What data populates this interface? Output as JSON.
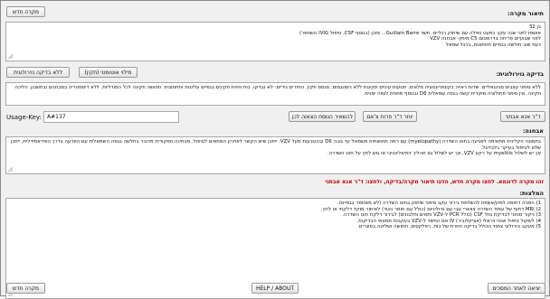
{
  "case": {
    "label": "תיאור מקרה:",
    "new_case_button": "מקרה חדש",
    "text": "בן 32\nאושפז לפני שנה עקב כמעט נפילה עם שיתוק רגליים. חשד Guillain Barre... מוכן (בנוסף CSF, טיפול IVIG השתפר)\nלפני שבועיים פריחה בדרמטום C5 מימין- אבחנה VZV\nכעת שוב חולשה בגפיים תחתונות, ברגל שמאל"
  },
  "neuro": {
    "label": "בדיקה נוירולוגית:",
    "btn_no_exam": "ללא בדיקה נוירולוגית",
    "btn_auto_fill": "מילוי אוטומטי (תקין)",
    "text": "ללא סימני עצבים מנינגאליים. שדות ראייה בקונפרונטציה מלאים. תנועות עיניים תקינות ללא ניסטגמוס. סנסס תקין. החזרים גידיים: לא נבדקו. כוח וחיות תקינים בגפיים עליונות ותחתונות. תחושה תקינה לכל המודליות. ללא דיסמטריה במבחנים ובחשבון. הליכה תקינה. אין סימני פתולוגיה מוקדית קשה בגפה שמאלית D6 ובנוסף מתחת לגפה ימנית."
  },
  "doctors": {
    "btn_1": "ד\"ר אנא אבתני",
    "btn_2": "יוחר ד\"ר פרוח צ'אם",
    "btn_3": "להשאיר הנוסח הצאוה לכן",
    "usage_key_label": "Usage-Key:",
    "usage_key_value": "A#137"
  },
  "diagnosis": {
    "label": "אבחנה:",
    "text": "בתמונה הקלינית מתאימה לפגיעה בחוט השדרה (myelopathy) עם רמה תחושתית משמאל עד גובה D6 ובהטבעות מעל VZV. ייתכן שיש הקשר לאחרון המתאים לטיפול. מבחינה תפקודית מדובר בחלשה בגפה השמאלית עם הפרעה בדרך הפיראמידלית, ייתכן שלא לטיפול בעיקר בלבדיגל.\nאך יש לשלול myelitis על רקע VZV, אך יש לשלול גם תהליך דמיאלינטיבי או גוש לחץ על חוט השדרה."
  },
  "warning": "זהו מקרה לדוגמא. לחצו מקרה חדש, הזינו תיאור מקרה/בדיקה, ולחצו: ד\"ר אנא אבתני",
  "recommendations": {
    "label": "המלצות:",
    "text": "1) הפניה דחופה למיון/אשפוז להשלמת בירור עקב סימני שיתוק בחוט השדרה (לא משתפר בגפיים).\n2) MRI דחוף של עמוד השדרה צווארי וגבי עם גדוליניום (כולל עם חומר ניגוד) לאיתור מוקד דלקתי או לחץ.\n3) ניקור מותני לבדיקת נוזל CSF (כולל PCR ל-VZV ותאים וחלבונים) לבירור דלקת חוט השדרה.\n4) לשקול טיפול אנטי ויראלי (אציקלוביר) IV אם החשד ל-VZV בעקבות ממצאי הבדיקות.\n5) מעקב נוירולוגי צמוד הכולל בדיקה חוזרת של כוח, רפלקסים, תחושה ושליטה בסוגרים."
  },
  "footer": {
    "exit_button": "יציאה לאתר המסכים",
    "help_button": "HELP / ABOUT",
    "new_case_button": "מקרה חדש"
  }
}
